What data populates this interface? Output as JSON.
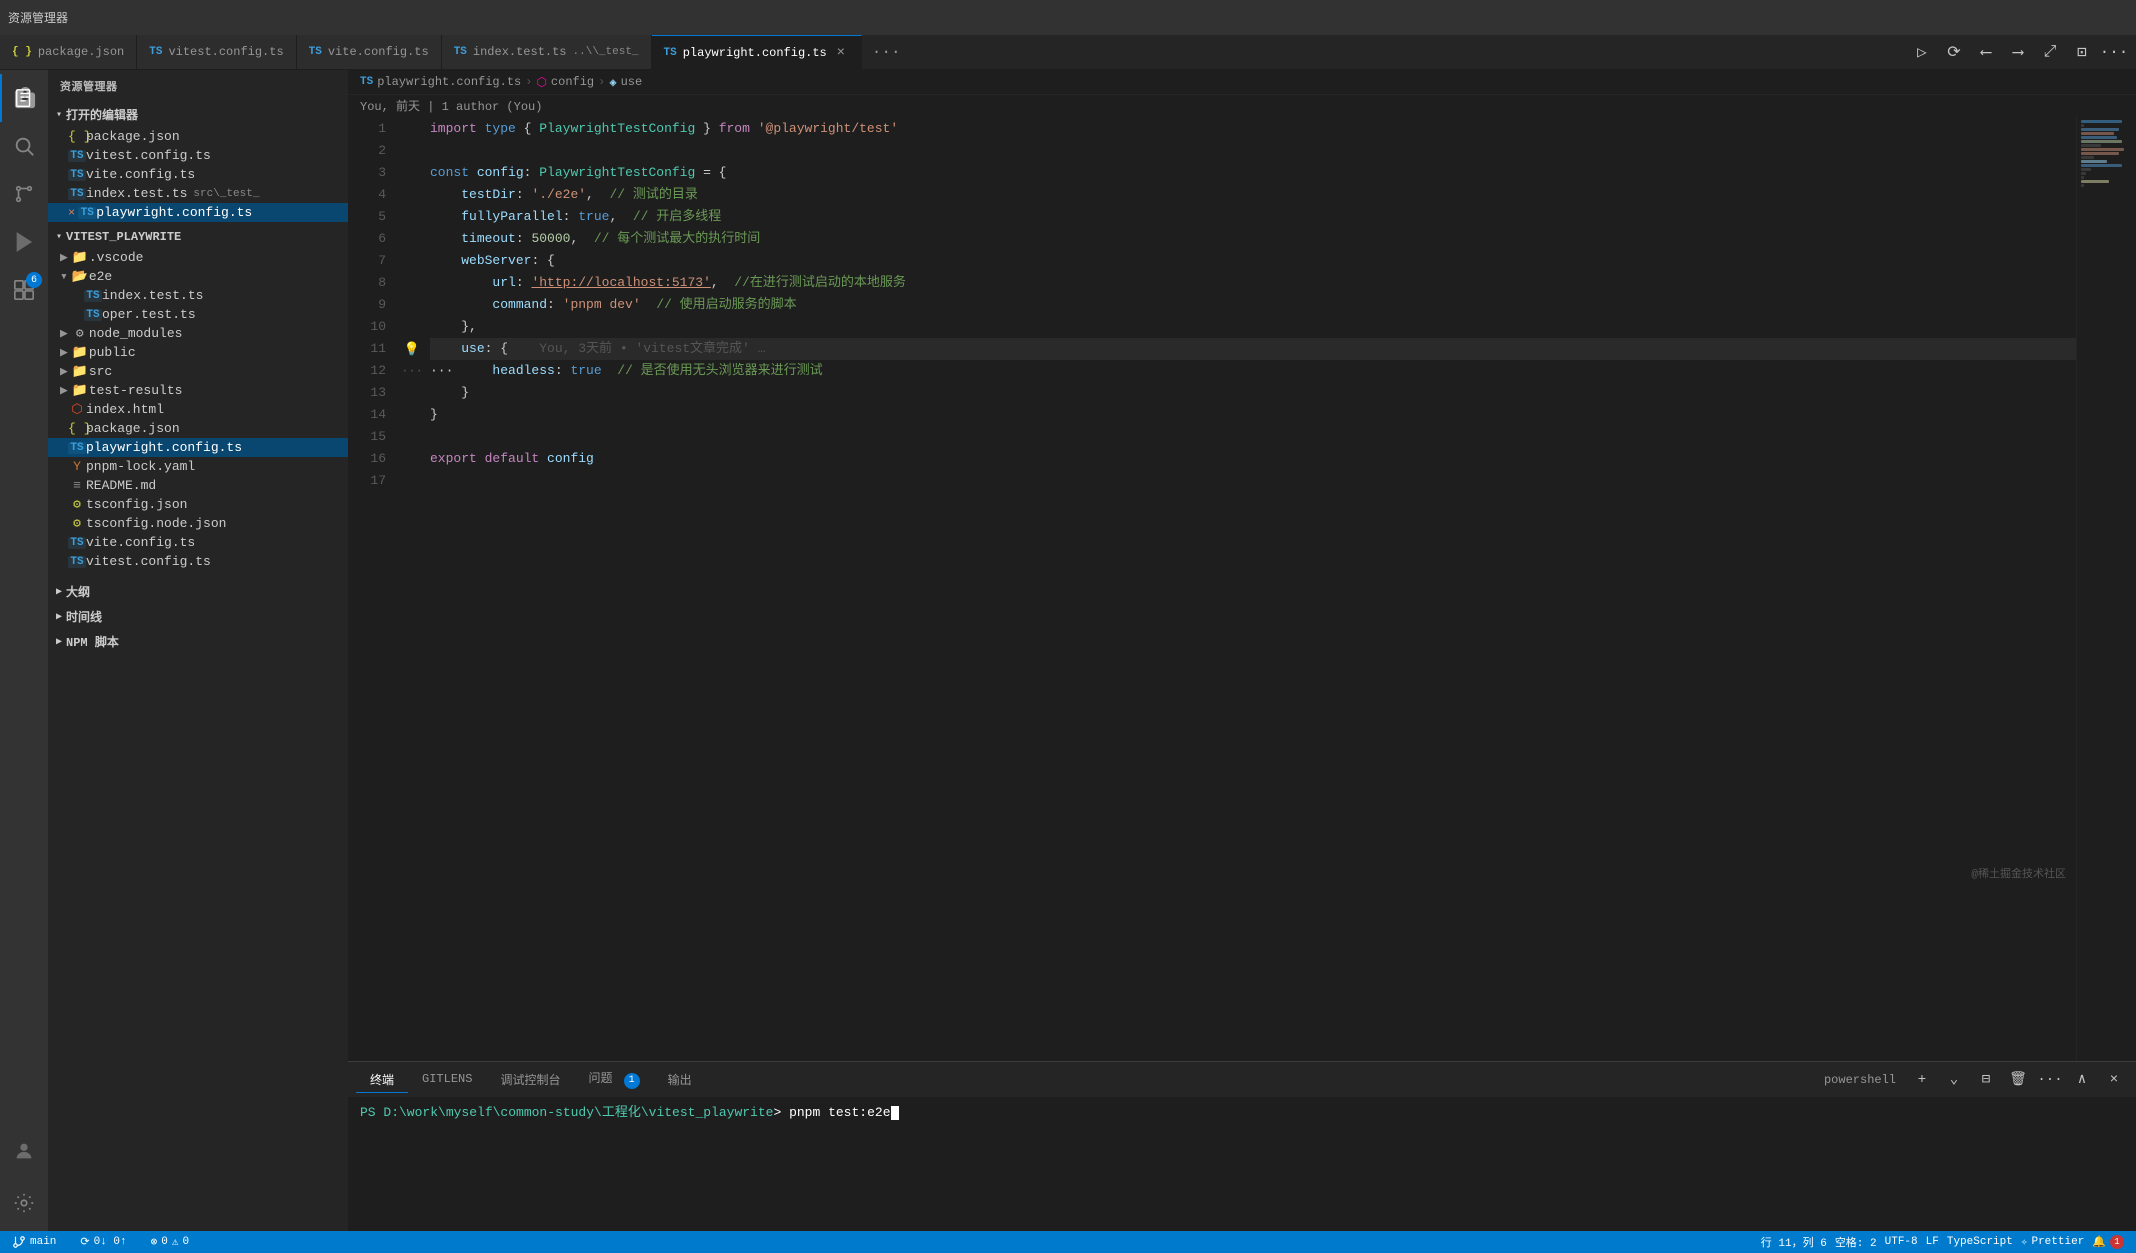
{
  "titlebar": {
    "title": "资源管理器"
  },
  "tabs": [
    {
      "id": "package-json",
      "label": "package.json",
      "icon": "json",
      "active": false,
      "modified": false
    },
    {
      "id": "vitest-config",
      "label": "vitest.config.ts",
      "icon": "ts",
      "active": false,
      "modified": false
    },
    {
      "id": "vite-config",
      "label": "vite.config.ts",
      "icon": "ts",
      "active": false,
      "modified": false
    },
    {
      "id": "index-test",
      "label": "index.test.ts",
      "icon": "ts",
      "active": false,
      "modified": false,
      "extra": "..\\_test_"
    },
    {
      "id": "playwright-config",
      "label": "playwright.config.ts",
      "icon": "ts",
      "active": true,
      "modified": false
    }
  ],
  "breadcrumb": {
    "items": [
      "playwright.config.ts",
      "config",
      "use"
    ]
  },
  "blame": {
    "text": "You, 前天 | 1 author (You)"
  },
  "sidebar": {
    "section_open": "打开的编辑器",
    "open_files": [
      {
        "name": "package.json",
        "icon": "json",
        "indent": 16
      },
      {
        "name": "vitest.config.ts",
        "icon": "ts",
        "indent": 16
      },
      {
        "name": "vite.config.ts",
        "icon": "ts",
        "indent": 16
      },
      {
        "name": "index.test.ts",
        "icon": "ts",
        "indent": 16,
        "extra": "src\\_test_"
      },
      {
        "name": "playwright.config.ts",
        "icon": "ts",
        "indent": 16,
        "active": true,
        "modified": true
      }
    ],
    "project_name": "VITEST_PLAYWRITE",
    "tree": [
      {
        "type": "folder",
        "name": ".vscode",
        "indent": 8,
        "collapsed": true
      },
      {
        "type": "folder",
        "name": "e2e",
        "indent": 8,
        "collapsed": false
      },
      {
        "type": "file",
        "name": "index.test.ts",
        "icon": "ts",
        "indent": 32
      },
      {
        "type": "file",
        "name": "oper.test.ts",
        "icon": "ts",
        "indent": 32
      },
      {
        "type": "folder",
        "name": "node_modules",
        "indent": 8,
        "collapsed": true
      },
      {
        "type": "folder",
        "name": "public",
        "indent": 8,
        "collapsed": true
      },
      {
        "type": "folder",
        "name": "src",
        "indent": 8,
        "collapsed": true
      },
      {
        "type": "folder",
        "name": "test-results",
        "indent": 8,
        "collapsed": true
      },
      {
        "type": "file",
        "name": "index.html",
        "icon": "html",
        "indent": 16
      },
      {
        "type": "file",
        "name": "package.json",
        "icon": "json",
        "indent": 16
      },
      {
        "type": "file",
        "name": "playwright.config.ts",
        "icon": "ts",
        "indent": 16,
        "active": true
      },
      {
        "type": "file",
        "name": "pnpm-lock.yaml",
        "icon": "yaml",
        "indent": 16
      },
      {
        "type": "file",
        "name": "README.md",
        "icon": "md",
        "indent": 16
      },
      {
        "type": "file",
        "name": "tsconfig.json",
        "icon": "json",
        "indent": 16
      },
      {
        "type": "file",
        "name": "tsconfig.node.json",
        "icon": "json",
        "indent": 16
      },
      {
        "type": "file",
        "name": "vite.config.ts",
        "icon": "ts",
        "indent": 16
      },
      {
        "type": "file",
        "name": "vitest.config.ts",
        "icon": "ts",
        "indent": 16
      }
    ]
  },
  "code": {
    "lines": [
      {
        "num": 1,
        "content": "import_type_code"
      },
      {
        "num": 2,
        "content": ""
      },
      {
        "num": 3,
        "content": "const_config_code"
      },
      {
        "num": 4,
        "content": "testdir_code"
      },
      {
        "num": 5,
        "content": "fullyparallel_code"
      },
      {
        "num": 6,
        "content": "timeout_code"
      },
      {
        "num": 7,
        "content": "webserver_code"
      },
      {
        "num": 8,
        "content": "url_code"
      },
      {
        "num": 9,
        "content": "command_code"
      },
      {
        "num": 10,
        "content": "close_brace"
      },
      {
        "num": 11,
        "content": "use_code",
        "lightbulb": true,
        "ghost": true
      },
      {
        "num": 12,
        "content": "headless_code",
        "dots": true
      },
      {
        "num": 13,
        "content": "close_use"
      },
      {
        "num": 14,
        "content": "close_outer"
      },
      {
        "num": 15,
        "content": ""
      },
      {
        "num": 16,
        "content": "export_default"
      },
      {
        "num": 17,
        "content": ""
      }
    ]
  },
  "terminal": {
    "tabs": [
      {
        "label": "终端",
        "active": true
      },
      {
        "label": "GITLENS",
        "active": false
      },
      {
        "label": "调试控制台",
        "active": false
      },
      {
        "label": "问题",
        "active": false,
        "badge": 1
      },
      {
        "label": "输出",
        "active": false
      }
    ],
    "shell_label": "powershell",
    "prompt": "PS D:\\work\\myself\\common-study\\工程化\\vitest_playwrite>",
    "command": "pnpm test:e2e"
  },
  "statusbar": {
    "branch": "main",
    "sync": "0↓ 0↑",
    "errors": "0",
    "warnings": "0",
    "outline_label": "大纲",
    "timeline_label": "时间线",
    "npm_label": "NPM 脚本",
    "right_items": [
      "行 11，列 6",
      "空格: 2",
      "UTF-8",
      "LF",
      "TypeScript",
      "Prettier"
    ],
    "watermark": "@稀土掘金技术社区"
  },
  "activity_bar": {
    "icons": [
      {
        "name": "explorer-icon",
        "symbol": "⬜",
        "active": true
      },
      {
        "name": "search-icon",
        "symbol": "🔍"
      },
      {
        "name": "git-icon",
        "symbol": "⑂"
      },
      {
        "name": "run-icon",
        "symbol": "▷"
      },
      {
        "name": "extensions-icon",
        "symbol": "⊞",
        "badge": 6
      },
      {
        "name": "avatar-icon",
        "symbol": "👤",
        "bottom": true
      }
    ]
  }
}
